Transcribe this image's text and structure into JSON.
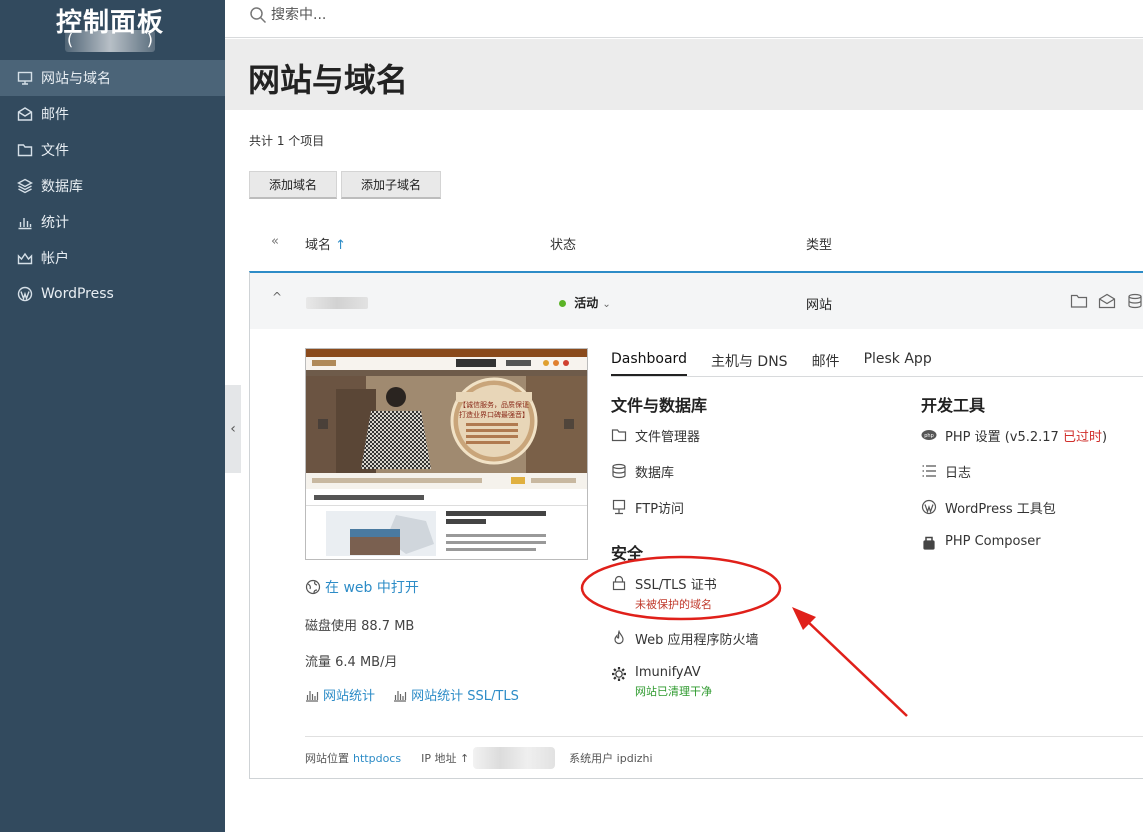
{
  "sidebar": {
    "logo_title": "控制面板",
    "logo_sub": "(",
    "logo_sub_close": ")",
    "items": [
      {
        "label": "网站与域名",
        "icon": "monitor-icon",
        "active": true
      },
      {
        "label": "邮件",
        "icon": "mail-icon"
      },
      {
        "label": "文件",
        "icon": "folder-icon"
      },
      {
        "label": "数据库",
        "icon": "layers-icon"
      },
      {
        "label": "统计",
        "icon": "stats-icon"
      },
      {
        "label": "帐户",
        "icon": "account-icon"
      },
      {
        "label": "WordPress",
        "icon": "wordpress-icon"
      }
    ],
    "collapse_glyph": "‹"
  },
  "search": {
    "placeholder": "搜索中..."
  },
  "page": {
    "title": "网站与域名",
    "count": "共计 1 个项目",
    "add_domain": "添加域名",
    "add_subdomain": "添加子域名"
  },
  "table": {
    "col_domain": "域名",
    "sort_glyph": "↑",
    "col_status": "状态",
    "col_type": "类型",
    "collapse_all_glyph": "⌃"
  },
  "domain": {
    "expand_glyph": "^",
    "status": "活动",
    "status_caret": "⌄",
    "type": "网站",
    "open_in_web": "在 web 中打开",
    "disk_usage": "磁盘使用 88.7 MB",
    "traffic": "流量 6.4 MB/月",
    "web_stats": "网站统计",
    "web_stats_ssl": "网站统计 SSL/TLS",
    "tabs": [
      "Dashboard",
      "主机与 DNS",
      "邮件",
      "Plesk App"
    ],
    "sections": {
      "files_db": "文件与数据库",
      "security": "安全",
      "dev_tools": "开发工具"
    },
    "files_tools": [
      {
        "label": "文件管理器",
        "icon": "folder-icon"
      },
      {
        "label": "数据库",
        "icon": "database-icon"
      },
      {
        "label": "FTP访问",
        "icon": "ftp-icon"
      }
    ],
    "security_tools": {
      "ssl": "SSL/TLS 证书",
      "ssl_sub": "未被保护的域名",
      "waf": "Web 应用程序防火墙",
      "imunify": "ImunifyAV",
      "imunify_sub": "网站已清理干净"
    },
    "dev_tools": {
      "php_prefix": "PHP 设置 (v5.2.17 ",
      "php_outdated": "已过时",
      "php_suffix": ")",
      "logs": "日志",
      "wp_toolkit": "WordPress 工具包",
      "composer": "PHP Composer"
    },
    "footer": {
      "site_location_label": "网站位置",
      "site_location_value": "httpdocs",
      "ip_label": "IP 地址 ↑",
      "sys_user": "系统用户 ipdizhi"
    },
    "thumbnail_headline_1": "【诚信服务，品质保证",
    "thumbnail_headline_2": "打造业界口碑最强音】"
  },
  "colors": {
    "sidebar_bg": "#324a5e",
    "accent": "#2d8cc7",
    "annotation_red": "#e0201a",
    "status_green": "#5bb327"
  }
}
